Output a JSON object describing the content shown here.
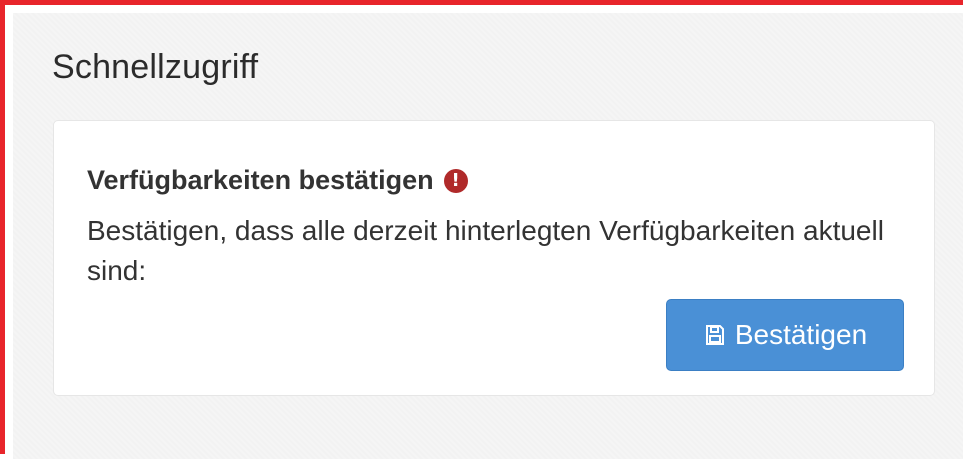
{
  "section": {
    "title": "Schnellzugriff"
  },
  "card": {
    "title": "Verfügbarkeiten bestätigen",
    "alert_icon": "exclamation-circle-icon",
    "alert_symbol": "!",
    "alert_color": "#b02a2a",
    "description": "Bestätigen, dass alle derzeit hinterlegten Verfügbarkeiten aktuell sind:",
    "button": {
      "label": "Bestätigen",
      "icon": "save-icon",
      "color": "#4a90d6"
    }
  },
  "colors": {
    "frame_border": "#e8252b"
  }
}
